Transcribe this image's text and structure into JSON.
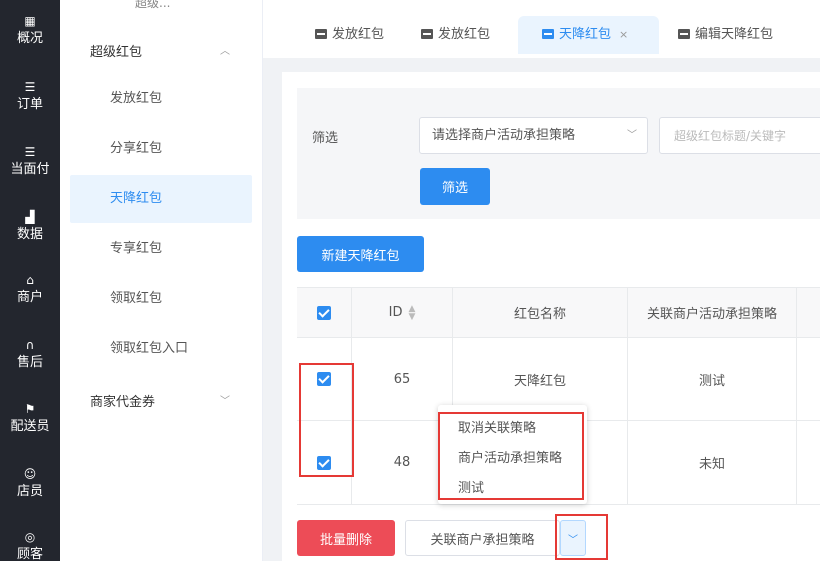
{
  "rail": [
    {
      "label": "概况",
      "icon": "dashboard-icon",
      "glyph": "▦"
    },
    {
      "label": "订单",
      "icon": "list-icon",
      "glyph": "☰"
    },
    {
      "label": "当面付",
      "icon": "list-icon",
      "glyph": "☰"
    },
    {
      "label": "数据",
      "icon": "bar-chart-icon",
      "glyph": "▟"
    },
    {
      "label": "商户",
      "icon": "store-icon",
      "glyph": "⌂"
    },
    {
      "label": "售后",
      "icon": "headset-icon",
      "glyph": "∩"
    },
    {
      "label": "配送员",
      "icon": "delivery-icon",
      "glyph": "⚑"
    },
    {
      "label": "店员",
      "icon": "staff-icon",
      "glyph": "☺"
    },
    {
      "label": "顾客",
      "icon": "customer-icon",
      "glyph": "◎"
    }
  ],
  "sidebar": {
    "top_label": "超级...",
    "group1": "超级红包",
    "items": [
      "发放红包",
      "分享红包",
      "天降红包",
      "专享红包",
      "领取红包",
      "领取红包入口"
    ],
    "group2": "商家代金券"
  },
  "tabs": [
    {
      "label": "发放红包"
    },
    {
      "label": "发放红包"
    },
    {
      "label": "天降红包",
      "close": "×"
    },
    {
      "label": "编辑天降红包"
    }
  ],
  "filter": {
    "label": "筛选",
    "select_value": "请选择商户活动承担策略",
    "input_placeholder": "超级红包标题/关键字",
    "button": "筛选"
  },
  "new_button": "新建天降红包",
  "table": {
    "headers": [
      "ID",
      "红包名称",
      "关联商户活动承担策略"
    ],
    "rows": [
      {
        "id": "65",
        "name": "天降红包",
        "strategy": "测试"
      },
      {
        "id": "48",
        "name": "",
        "strategy": "未知"
      }
    ]
  },
  "dropdown": [
    "取消关联策略",
    "商户活动承担策略",
    "测试"
  ],
  "footer": {
    "batch_delete": "批量删除",
    "link_strategy": "关联商户承担策略"
  },
  "colors": {
    "primary": "#2d8cf0",
    "danger": "#ed4c57",
    "rail_bg": "#23262e",
    "annotation": "#e53935"
  }
}
